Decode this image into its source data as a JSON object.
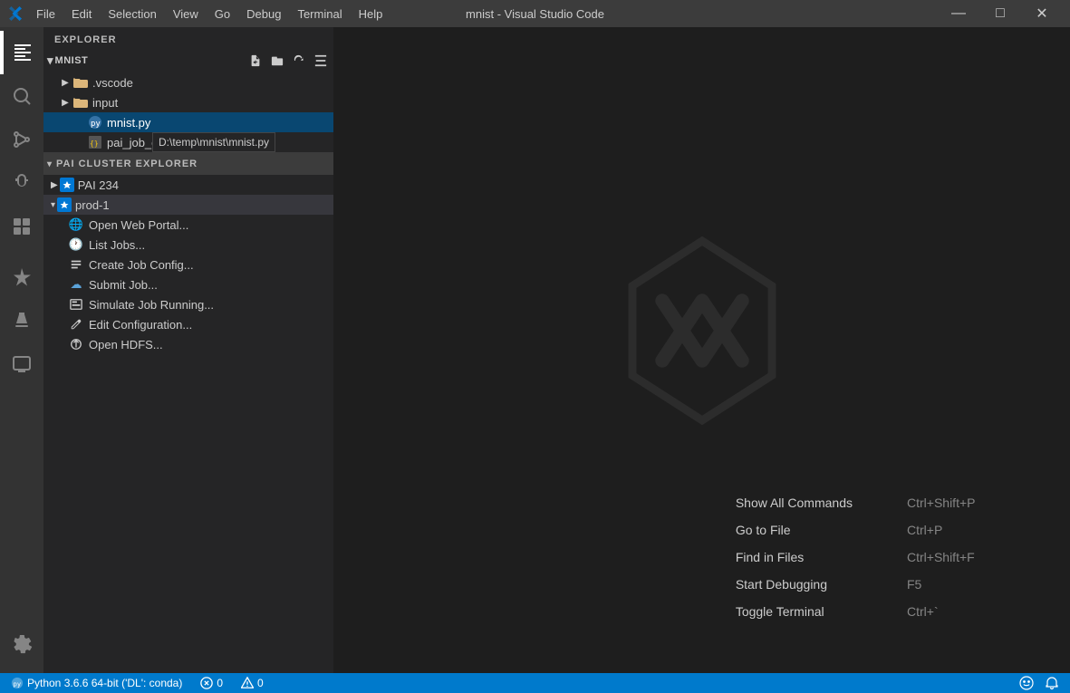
{
  "titlebar": {
    "title": "mnist - Visual Studio Code",
    "menu_items": [
      "File",
      "Edit",
      "Selection",
      "View",
      "Go",
      "Debug",
      "Terminal",
      "Help"
    ],
    "win_minimize": "—",
    "win_restore": "□",
    "win_close": "✕"
  },
  "activity_bar": {
    "icons": [
      {
        "name": "explorer-icon",
        "symbol": "⧉",
        "active": true
      },
      {
        "name": "search-icon",
        "symbol": "🔍",
        "active": false
      },
      {
        "name": "source-control-icon",
        "symbol": "⑂",
        "active": false
      },
      {
        "name": "debug-icon",
        "symbol": "▷",
        "active": false
      },
      {
        "name": "extensions-icon",
        "symbol": "⊞",
        "active": false
      },
      {
        "name": "pai-icon",
        "symbol": "✦",
        "active": false
      },
      {
        "name": "flask-icon",
        "symbol": "⚗",
        "active": false
      },
      {
        "name": "remote-icon",
        "symbol": "⊡",
        "active": false
      }
    ],
    "bottom_icon": {
      "name": "settings-icon",
      "symbol": "⚙"
    }
  },
  "sidebar": {
    "explorer_label": "EXPLORER",
    "project_name": "MNIST",
    "actions": [
      {
        "name": "new-file-action",
        "symbol": "+"
      },
      {
        "name": "new-folder-action",
        "symbol": "📁"
      },
      {
        "name": "refresh-action",
        "symbol": "↻"
      },
      {
        "name": "collapse-action",
        "symbol": "⊟"
      }
    ],
    "tree": [
      {
        "type": "folder",
        "name": ".vscode",
        "indent": 16,
        "expanded": false
      },
      {
        "type": "folder",
        "name": "input",
        "indent": 16,
        "expanded": false
      },
      {
        "type": "file-py",
        "name": "mnist.py",
        "indent": 32,
        "selected": true
      },
      {
        "type": "file-json",
        "name": "pai_job_config.json",
        "indent": 32,
        "selected": false
      }
    ],
    "tooltip": "D:\\temp\\mnist\\mnist.py"
  },
  "pai_explorer": {
    "section_label": "PAI CLUSTER EXPLORER",
    "clusters": [
      {
        "name": "PAI 234",
        "expanded": false,
        "children": []
      },
      {
        "name": "prod-1",
        "expanded": true,
        "children": [
          {
            "icon": "globe-icon",
            "icon_char": "🌐",
            "label": "Open Web Portal..."
          },
          {
            "icon": "clock-icon",
            "icon_char": "🕐",
            "label": "List Jobs..."
          },
          {
            "icon": "file-icon",
            "icon_char": "📄",
            "label": "Create Job Config..."
          },
          {
            "icon": "upload-icon",
            "icon_char": "☁",
            "label": "Submit Job..."
          },
          {
            "icon": "play-icon",
            "icon_char": "▶",
            "label": "Simulate Job Running..."
          },
          {
            "icon": "edit-icon",
            "icon_char": "✎",
            "label": "Edit Configuration..."
          },
          {
            "icon": "hdfs-icon",
            "icon_char": "⚓",
            "label": "Open HDFS..."
          }
        ]
      }
    ]
  },
  "editor": {
    "welcome_commands": [
      {
        "name": "Show All Commands",
        "shortcut": "Ctrl+Shift+P"
      },
      {
        "name": "Go to File",
        "shortcut": "Ctrl+P"
      },
      {
        "name": "Find in Files",
        "shortcut": "Ctrl+Shift+F"
      },
      {
        "name": "Start Debugging",
        "shortcut": "F5"
      },
      {
        "name": "Toggle Terminal",
        "shortcut": "Ctrl+`"
      }
    ]
  },
  "statusbar": {
    "python_info": "Python 3.6.6 64-bit ('DL': conda)",
    "error_count": "0",
    "warning_count": "0",
    "error_icon": "✕",
    "warning_icon": "⚠",
    "smiley_icon": "🙂",
    "bell_icon": "🔔"
  }
}
